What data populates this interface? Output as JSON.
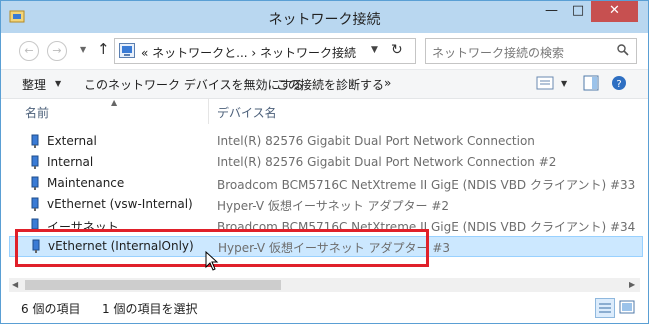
{
  "window": {
    "title": "ネットワーク接続",
    "minimize": "—",
    "maximize": "□",
    "close": "✕"
  },
  "nav": {
    "back_icon": "arrow-left-icon",
    "forward_icon": "arrow-right-icon",
    "up_icon": "arrow-up-icon"
  },
  "address": {
    "breadcrumb": "«  ネットワークと...  ›  ネットワーク接続",
    "dropdown": "▼",
    "refresh": "↻"
  },
  "search": {
    "placeholder": "ネットワーク接続の検索"
  },
  "toolbar": {
    "organize": "整理",
    "disable": "このネットワーク デバイスを無効にする",
    "diagnose": "この接続を診断する",
    "more": "»"
  },
  "columns": {
    "name": "名前",
    "device": "デバイス名"
  },
  "rows": [
    {
      "name": "External",
      "device": "Intel(R) 82576 Gigabit Dual Port Network Connection"
    },
    {
      "name": "Internal",
      "device": "Intel(R) 82576 Gigabit Dual Port Network Connection #2"
    },
    {
      "name": "Maintenance",
      "device": "Broadcom BCM5716C NetXtreme II GigE (NDIS VBD クライアント) #33"
    },
    {
      "name": "vEthernet (vsw-Internal)",
      "device": "Hyper-V 仮想イーサネット アダプター #2"
    },
    {
      "name": "イーサネット",
      "device": "Broadcom BCM5716C NetXtreme II GigE (NDIS VBD クライアント) #34"
    },
    {
      "name": "vEthernet (InternalOnly)",
      "device": "Hyper-V 仮想イーサネット アダプター #3",
      "selected": true
    }
  ],
  "status": {
    "count": "6 個の項目",
    "selected": "1 個の項目を選択"
  },
  "colors": {
    "titlebar": "#b9d7f0",
    "selection": "#cce8ff",
    "highlight": "#e0202a",
    "close": "#c75050"
  }
}
